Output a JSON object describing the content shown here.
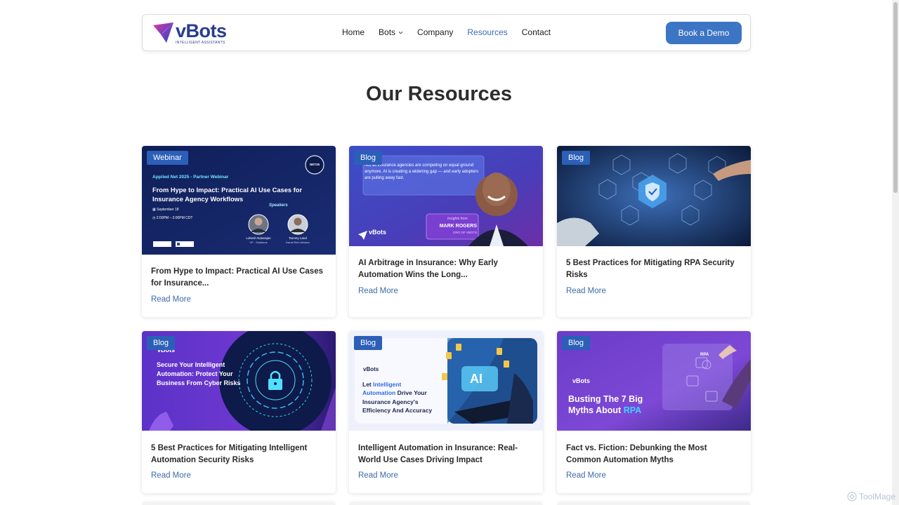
{
  "header": {
    "logo": {
      "word": "vBots",
      "tagline": "INTELLIGENT ASSISTANTS"
    },
    "nav": [
      {
        "label": "Home"
      },
      {
        "label": "Bots"
      },
      {
        "label": "Company"
      },
      {
        "label": "Resources"
      },
      {
        "label": "Contact"
      }
    ],
    "cta_label": "Book a Demo"
  },
  "page": {
    "title": "Our Resources"
  },
  "read_more_label": "Read More",
  "cards": [
    {
      "badge": "Webinar",
      "title": "From Hype to Impact: Practical AI Use Cases for Insurance...",
      "image": {
        "event_line": "Applied Net 2025 - Partner Webinar",
        "headline": "From Hype to Impact: Practical AI Use Cases for Insurance Agency Workflows",
        "date": "September 18",
        "time": "2:00PM – 3:00PM CDT",
        "speakers_label": "Speakers",
        "speaker1_name": "Lokesh Natarajan",
        "speaker1_role": "VP - Solutions",
        "speaker2_name": "Tammy Land",
        "speaker2_role": "InsureTech Advisor",
        "badge_text": "NET25"
      }
    },
    {
      "badge": "Blog",
      "title": "AI Arbitrage in Insurance: Why Early Automation Wins the Long...",
      "image": {
        "quote": "Not all insurance agencies are competing on equal ground anymore. AI is creating a widening gap — and early adopters are pulling away fast.",
        "insights_from": "Insights from",
        "person": "MARK ROGERS",
        "role": "CRO OF VBOTS",
        "logo_word": "vBots"
      }
    },
    {
      "badge": "Blog",
      "title": "5 Best Practices for Mitigating RPA Security Risks",
      "image": {}
    },
    {
      "badge": "Blog",
      "title": "5 Best Practices for Mitigating Intelligent Automation Security Risks",
      "image": {
        "logo_word": "vBots",
        "headline": "Secure Your Intelligent Automation: Protect Your Business From Cyber Risks"
      }
    },
    {
      "badge": "Blog",
      "title": "Intelligent Automation in Insurance: Real-World Use Cases Driving Impact",
      "image": {
        "logo_word": "vBots",
        "line1": "Let",
        "line1b": "Intelligent",
        "line2a": "Automation",
        "line2b": "Drive Your",
        "line3": "Insurance Agency's",
        "line4": "Efficiency And Accuracy",
        "ai_text": "AI"
      }
    },
    {
      "badge": "Blog",
      "title": "Fact vs. Fiction: Debunking the Most Common Automation Myths",
      "image": {
        "logo_word": "vBots",
        "line1": "Busting The 7 Big",
        "line2a": "Myths About",
        "line2b": "RPA",
        "rpa_label": "RPA"
      }
    }
  ],
  "watermark": "ToolMage",
  "colors": {
    "accent": "#3c75c4",
    "badge": "#2b5fb8",
    "link": "#3c6ca8",
    "nav_active": "#3c6cb4"
  }
}
